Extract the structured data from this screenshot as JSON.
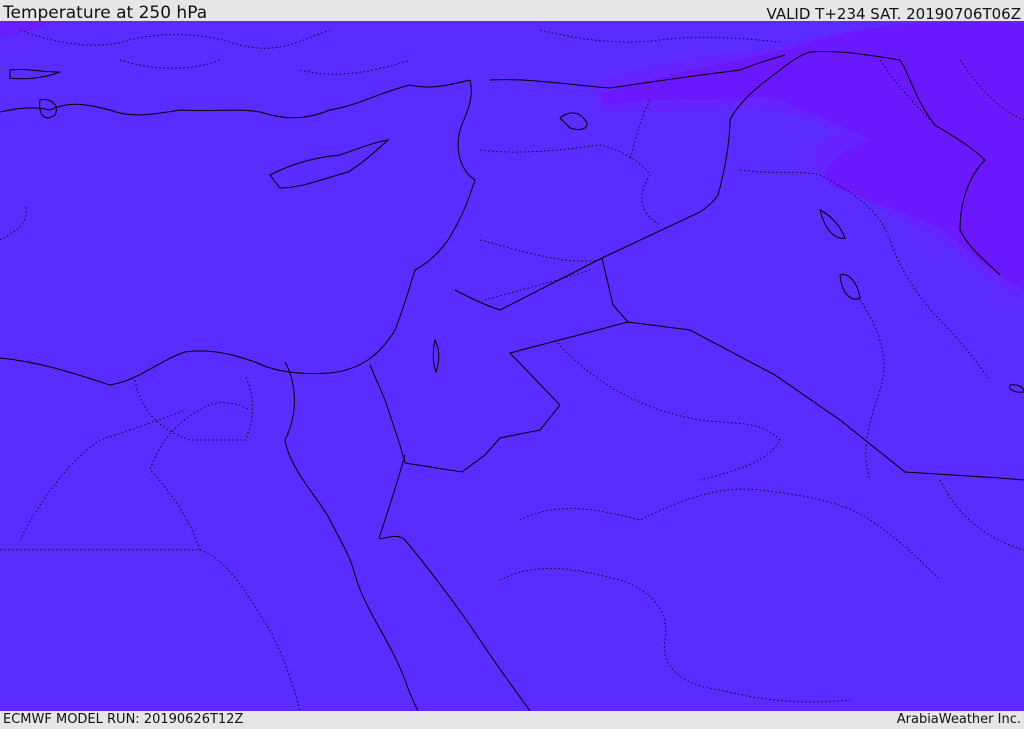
{
  "header": {
    "title": "Temperature at 250 hPa",
    "valid": "VALID T+234 SAT. 20190706T06Z"
  },
  "footer": {
    "model_run": "ECMWF MODEL RUN: 20190626T12Z",
    "credit": "ArabiaWeather Inc."
  },
  "colors": {
    "base_fill": "#5b2bff",
    "colder_fill": "#6c18ff",
    "cold_band": "#6624ff",
    "coast_line": "#000000",
    "border_line": "#000000"
  }
}
